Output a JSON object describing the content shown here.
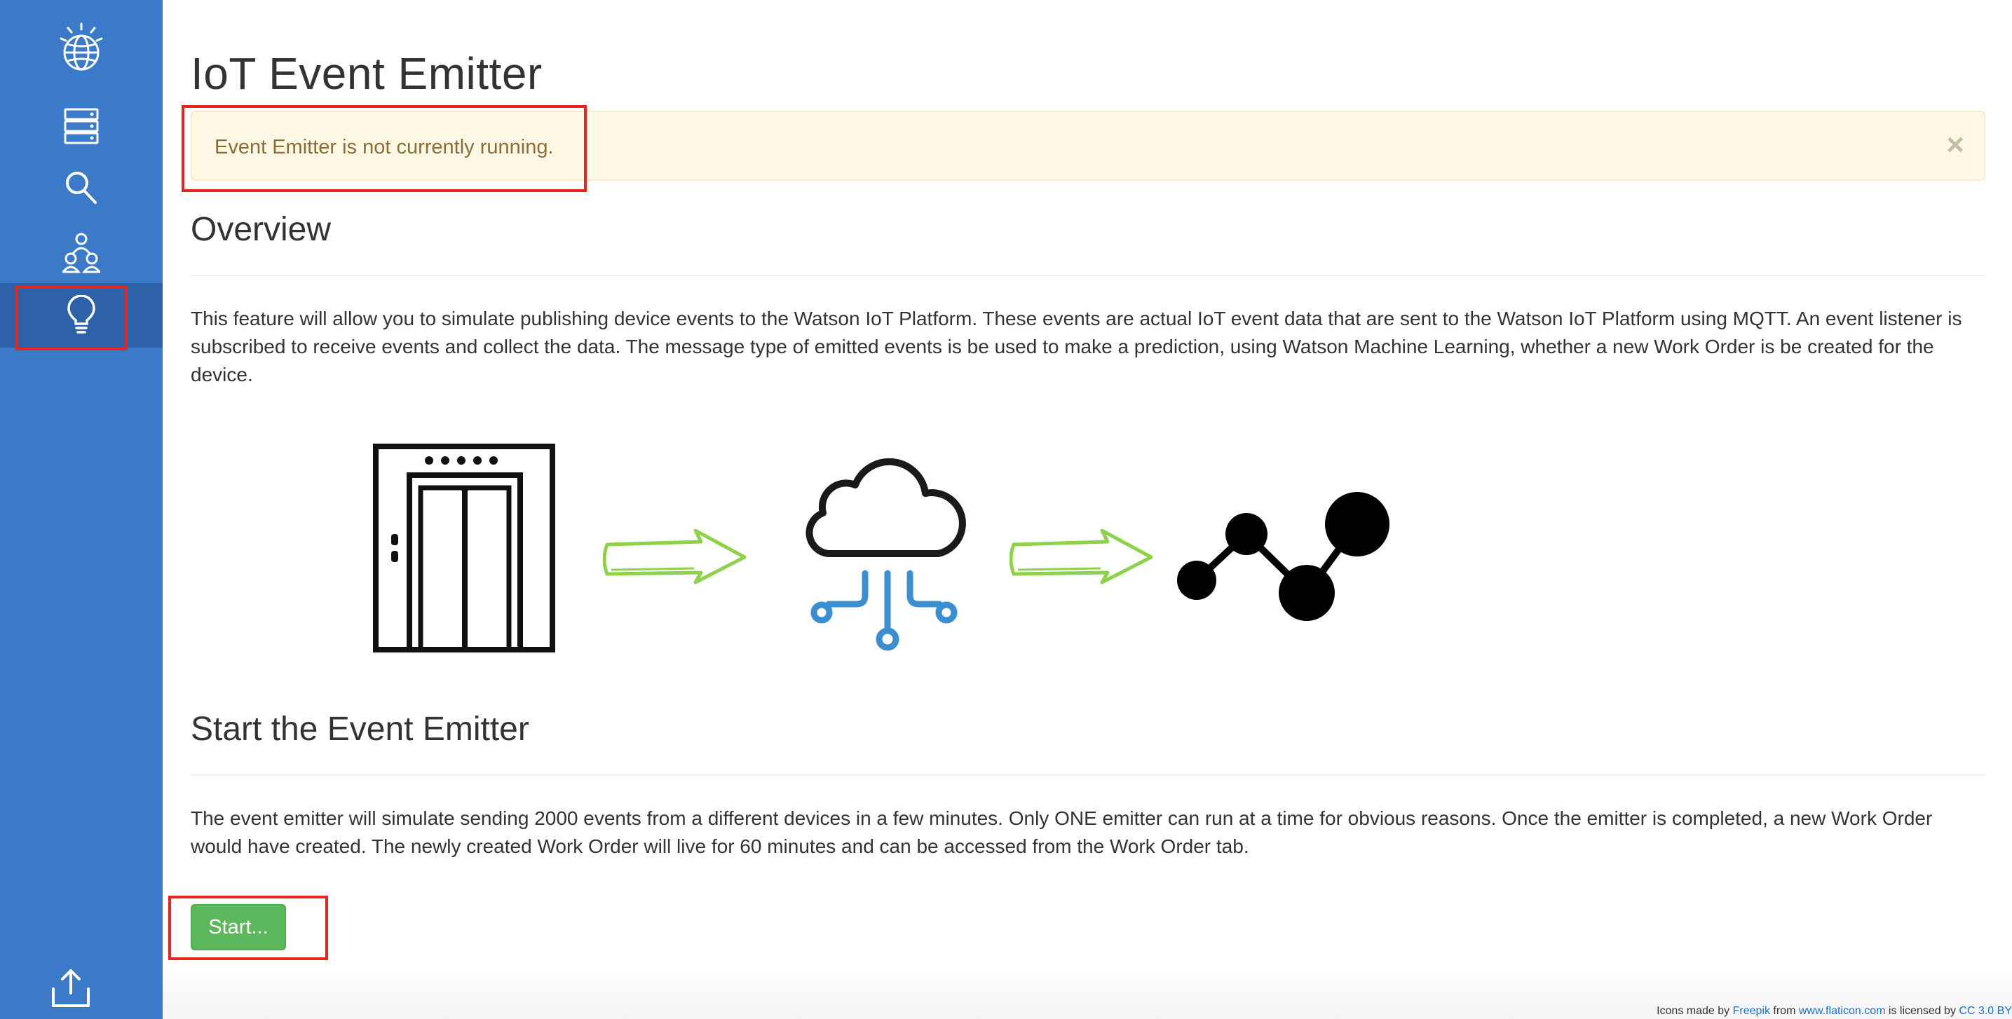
{
  "header": {
    "title": "IoT Event Emitter"
  },
  "alert": {
    "text": "Event Emitter is not currently running.",
    "close": "×"
  },
  "overview": {
    "heading": "Overview",
    "text": "This feature will allow you to simulate publishing device events to the Watson IoT Platform. These events are actual IoT event data that are sent to the Watson IoT Platform using MQTT. An event listener is subscribed to receive events and collect the data. The message type of emitted events is be used to make a prediction, using Watson Machine Learning, whether a new Work Order is be created for the device."
  },
  "start_section": {
    "heading": "Start the Event Emitter",
    "text": "The event emitter will simulate sending 2000 events from a different devices in a few minutes. Only ONE emitter can run at a time for obvious reasons. Once the emitter is completed, a new Work Order would have created. The newly created Work Order will live for 60 minutes and can be accessed from the Work Order tab.",
    "button": "Start..."
  },
  "credit": {
    "prefix": "Icons made by",
    "author": "Freepik",
    "from": "from",
    "site": "www.flaticon.com",
    "licensed": "is licensed by",
    "license": "CC 3.0 BY"
  },
  "sidebar": {
    "items": [
      {
        "icon": "globe-logo-icon"
      },
      {
        "icon": "server-icon"
      },
      {
        "icon": "search-icon"
      },
      {
        "icon": "users-icon"
      },
      {
        "icon": "lightbulb-icon",
        "active": true
      },
      {
        "icon": "upload-icon"
      }
    ]
  },
  "colors": {
    "sidebar": "#3b79c9",
    "sidebar_active": "#2d62a8",
    "alert_bg": "#fcf8e3",
    "alert_text": "#8a6d3b",
    "button": "#5cb85c",
    "highlight": "#e3261f",
    "arrow": "#8ed14b",
    "iot_blue": "#3b8fd1"
  }
}
